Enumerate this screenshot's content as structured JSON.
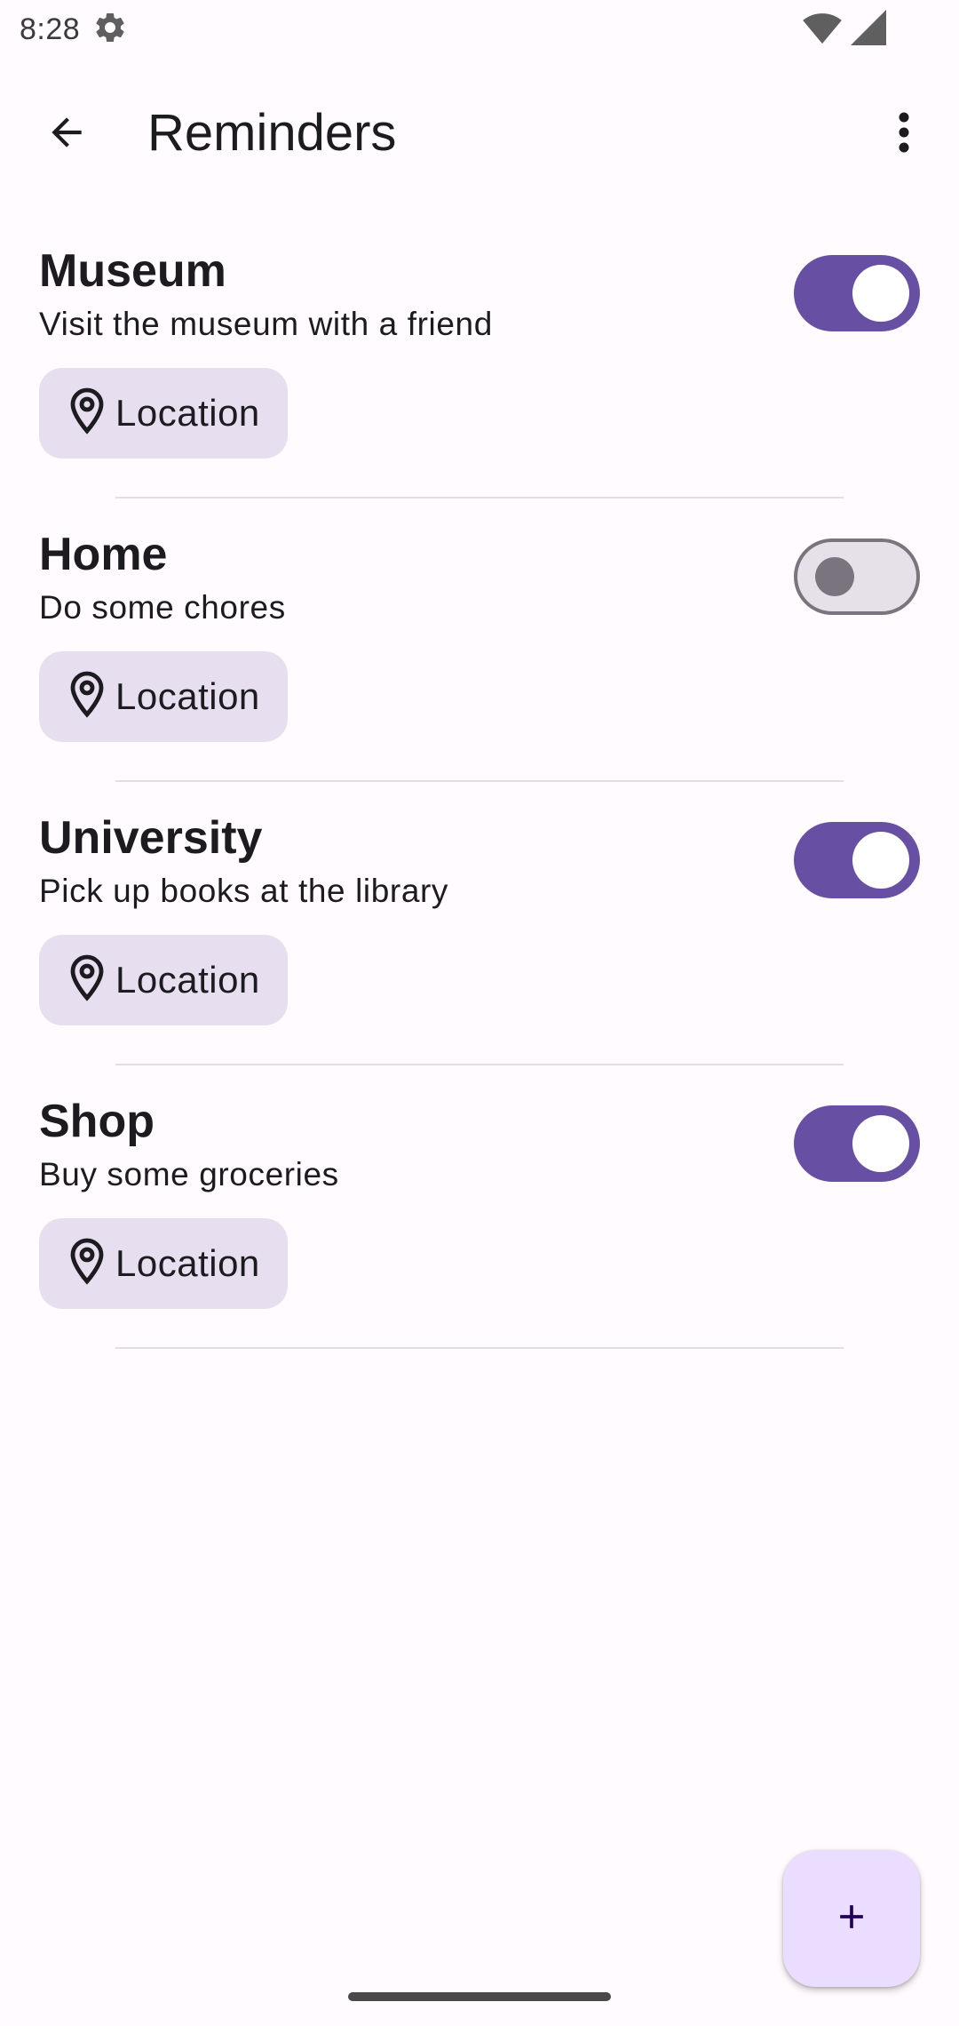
{
  "status_bar": {
    "time": "8:28",
    "icons": [
      "settings-gear-icon",
      "wifi-icon",
      "signal-icon"
    ]
  },
  "app_bar": {
    "title": "Reminders",
    "back_icon": "arrow-back-icon",
    "more_icon": "more-vert-icon"
  },
  "reminders": [
    {
      "title": "Museum",
      "description": "Visit the museum with a friend",
      "chip_label": "Location",
      "enabled": true
    },
    {
      "title": "Home",
      "description": "Do some chores",
      "chip_label": "Location",
      "enabled": false
    },
    {
      "title": "University",
      "description": "Pick up books at the library",
      "chip_label": "Location",
      "enabled": true
    },
    {
      "title": "Shop",
      "description": "Buy some groceries",
      "chip_label": "Location",
      "enabled": true
    }
  ],
  "fab": {
    "icon": "plus-icon"
  },
  "colors": {
    "primary": "#6750a4",
    "chip_background": "#e7dff0",
    "fab_background": "#eaddff",
    "surface": "#fffbfe"
  }
}
